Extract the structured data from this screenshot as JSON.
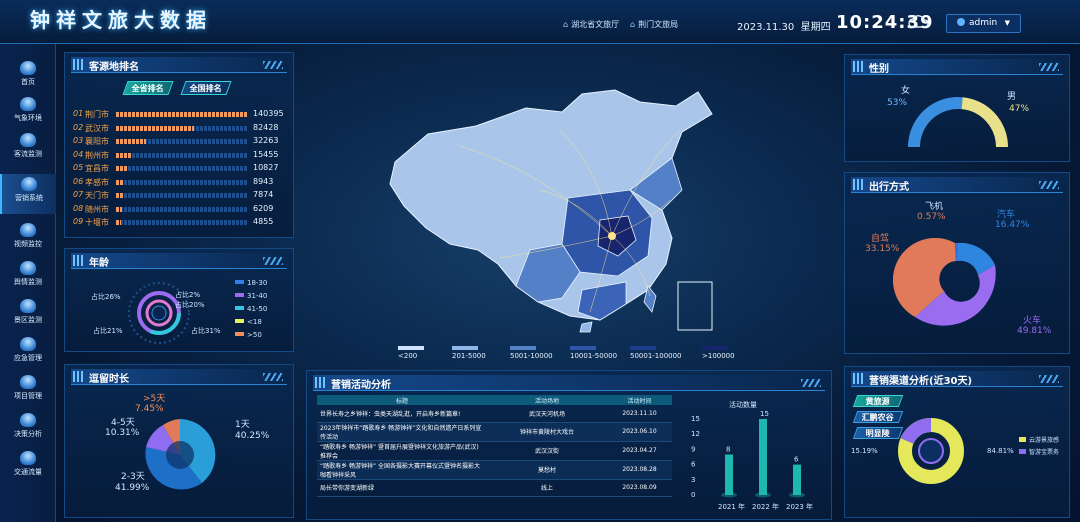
{
  "header": {
    "title": "钟祥文旅大数据",
    "links": [
      "湖北省文旅厅",
      "荆门文旅局"
    ],
    "date": "2023.11.30",
    "weekday": "星期四",
    "time": "10:24:39",
    "user": "admin"
  },
  "sidebar": {
    "items": [
      "首页",
      "气象环境",
      "客流监测",
      "营销系统",
      "视频监控",
      "舆情监测",
      "景区监测",
      "应急管理",
      "项目管理",
      "决策分析",
      "交通流量"
    ],
    "active_index": 3
  },
  "ranking": {
    "title": "客源地排名",
    "tabs": [
      "全省排名",
      "全国排名"
    ],
    "rows": [
      {
        "no": "01",
        "name": "荆门市",
        "value": "140395",
        "pct": 1.0
      },
      {
        "no": "02",
        "name": "武汉市",
        "value": "82428",
        "pct": 0.59
      },
      {
        "no": "03",
        "name": "襄阳市",
        "value": "32263",
        "pct": 0.23
      },
      {
        "no": "04",
        "name": "荆州市",
        "value": "15455",
        "pct": 0.11
      },
      {
        "no": "05",
        "name": "宜昌市",
        "value": "10827",
        "pct": 0.08
      },
      {
        "no": "06",
        "name": "孝感市",
        "value": "8943",
        "pct": 0.064
      },
      {
        "no": "07",
        "name": "天门市",
        "value": "7874",
        "pct": 0.056
      },
      {
        "no": "08",
        "name": "随州市",
        "value": "6209",
        "pct": 0.044
      },
      {
        "no": "09",
        "name": "十堰市",
        "value": "4855",
        "pct": 0.035
      }
    ]
  },
  "age": {
    "title": "年龄",
    "labels": [
      "占比26%",
      "占比2%",
      "占比20%",
      "占比21%",
      "占比31%"
    ],
    "legend": [
      {
        "label": "18-30",
        "color": "#2f7fe8"
      },
      {
        "label": "31-40",
        "color": "#9b6cf0"
      },
      {
        "label": "41-50",
        "color": "#34c8e0"
      },
      {
        "label": "<18",
        "color": "#e8f060"
      },
      {
        "label": ">50",
        "color": "#f0905a"
      }
    ]
  },
  "stay": {
    "title": "逗留时长",
    "labels": [
      {
        "name": "1天",
        "pct": "40.25%"
      },
      {
        "name": "2-3天",
        "pct": "41.99%"
      },
      {
        "name": "4-5天",
        "pct": "10.31%"
      },
      {
        "name": ">5天",
        "pct": "7.45%"
      }
    ]
  },
  "map": {
    "legend": [
      {
        "label": "<200",
        "color": "#cfe3ff"
      },
      {
        "label": "201-5000",
        "color": "#8fb6e8"
      },
      {
        "label": "5001-10000",
        "color": "#5480c8"
      },
      {
        "label": "10001-50000",
        "color": "#2f55a8"
      },
      {
        "label": "50001-100000",
        "color": "#1e3c8c"
      },
      {
        "label": ">100000",
        "color": "#16256e"
      }
    ]
  },
  "marketing": {
    "title": "营销活动分析",
    "columns": [
      "标题",
      "活动场地",
      "活动时间"
    ],
    "rows": [
      [
        "世界长寿之乡钟祥：虫类天湖乱逛，开启寿乡新篇章!",
        "武汉天河机场",
        "2023.11.10"
      ],
      [
        "2023年钟祥市“踏歌寿乡 畅游钟祥”文化和自然遗产日系列宣传活动",
        "钟祥市黄陵村大戏台",
        "2023.06.10"
      ],
      [
        "“踏歌寿乡 畅游钟祥” 暨首届升展暨钟祥文化旅游产品(武汉)推荐会",
        "武汉汉街",
        "2023.04.27"
      ],
      [
        "“踏歌寿乡 畅游钟祥” 全国各摄影大赛开幕仪式暨钟名摄影大咖看钟祥采风",
        "莫愁村",
        "2023.08.28"
      ],
      [
        "局长带你游变湖新绿",
        "线上",
        "2023.08.09"
      ]
    ],
    "count_title": "活动数量"
  },
  "chart_data": {
    "type": "bar",
    "title": "活动数量",
    "categories": [
      "2021 年",
      "2022 年",
      "2023 年"
    ],
    "values": [
      8,
      15,
      6
    ],
    "ylim": [
      0,
      15
    ],
    "yticks": [
      0,
      3,
      6,
      9,
      12,
      15
    ]
  },
  "gender": {
    "title": "性别",
    "female": {
      "name": "女",
      "pct": "53%",
      "value": 0.53
    },
    "male": {
      "name": "男",
      "pct": "47%",
      "value": 0.47
    }
  },
  "travel": {
    "title": "出行方式",
    "items": [
      {
        "name": "飞机",
        "pct": "0.57%",
        "color": "#3a6fd8"
      },
      {
        "name": "汽车",
        "pct": "16.47%",
        "color": "#2f86e0"
      },
      {
        "name": "自驾",
        "pct": "33.15%",
        "color": "#e07a5a"
      },
      {
        "name": "火车",
        "pct": "49.81%",
        "color": "#9a6cf0"
      }
    ]
  },
  "channel": {
    "title": "营销渠道分析(近30天)",
    "tabs": [
      "黄旅源",
      "汇鹏农谷",
      "明显陵"
    ],
    "left_pct": "15.19%",
    "right_pct": "84.81%",
    "legend": [
      {
        "label": "云游景旅感",
        "color": "#e4e85a"
      },
      {
        "label": "智游宝票务",
        "color": "#8f6cf0"
      }
    ]
  }
}
